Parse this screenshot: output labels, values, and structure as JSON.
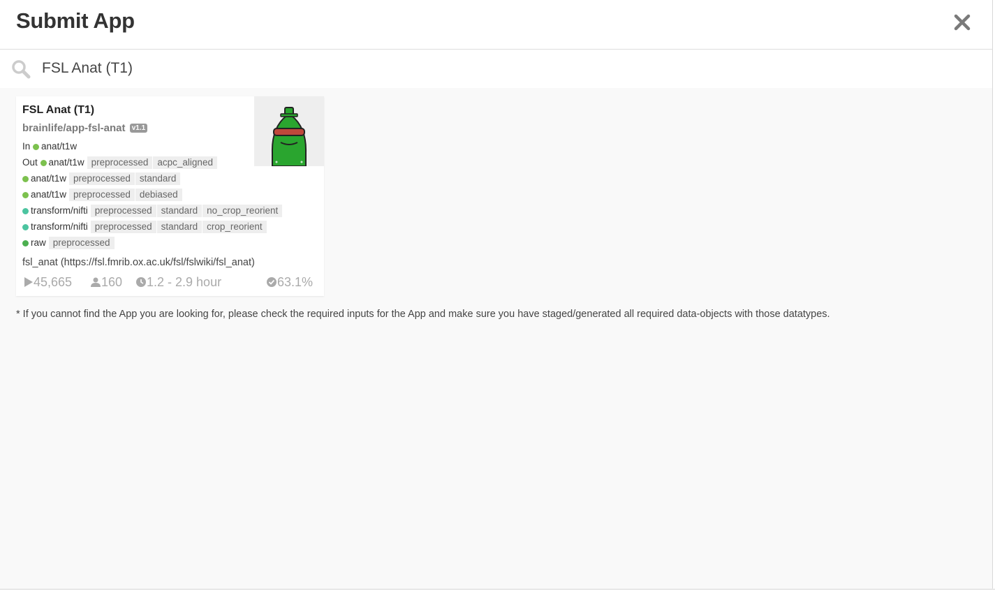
{
  "header": {
    "title": "Submit App",
    "close_icon": "close-icon"
  },
  "search": {
    "value": "FSL Anat (T1)",
    "icon": "search-icon"
  },
  "app_card": {
    "name": "FSL Anat (T1)",
    "repo": "brainlife/app-fsl-anat",
    "version": "v1.1",
    "input_label": "In",
    "output_label": "Out",
    "inputs": [
      {
        "datatype": "anat/t1w",
        "color": "#7cc14e",
        "tags": []
      }
    ],
    "outputs": [
      {
        "datatype": "anat/t1w",
        "color": "#7cc14e",
        "tags": [
          "preprocessed",
          "acpc_aligned"
        ]
      },
      {
        "datatype": "anat/t1w",
        "color": "#7cc14e",
        "tags": [
          "preprocessed",
          "standard"
        ]
      },
      {
        "datatype": "anat/t1w",
        "color": "#7cc14e",
        "tags": [
          "preprocessed",
          "debiased"
        ]
      },
      {
        "datatype": "transform/nifti",
        "color": "#4cc4a0",
        "tags": [
          "preprocessed",
          "standard",
          "no_crop_reorient"
        ]
      },
      {
        "datatype": "transform/nifti",
        "color": "#4cc4a0",
        "tags": [
          "preprocessed",
          "standard",
          "crop_reorient"
        ]
      },
      {
        "datatype": "raw",
        "color": "#4caf50",
        "tags": [
          "preprocessed"
        ]
      }
    ],
    "description": "fsl_anat (https://fsl.fmrib.ox.ac.uk/fsl/fslwiki/fsl_anat)",
    "stats": {
      "runs": "45,665",
      "users": "160",
      "runtime": "1.2 - 2.9 hour",
      "success": "63.1%"
    }
  },
  "footnote": "* If you cannot find the App you are looking for, please check the required inputs for the App and make sure you have staged/generated all required data-objects with those datatypes."
}
